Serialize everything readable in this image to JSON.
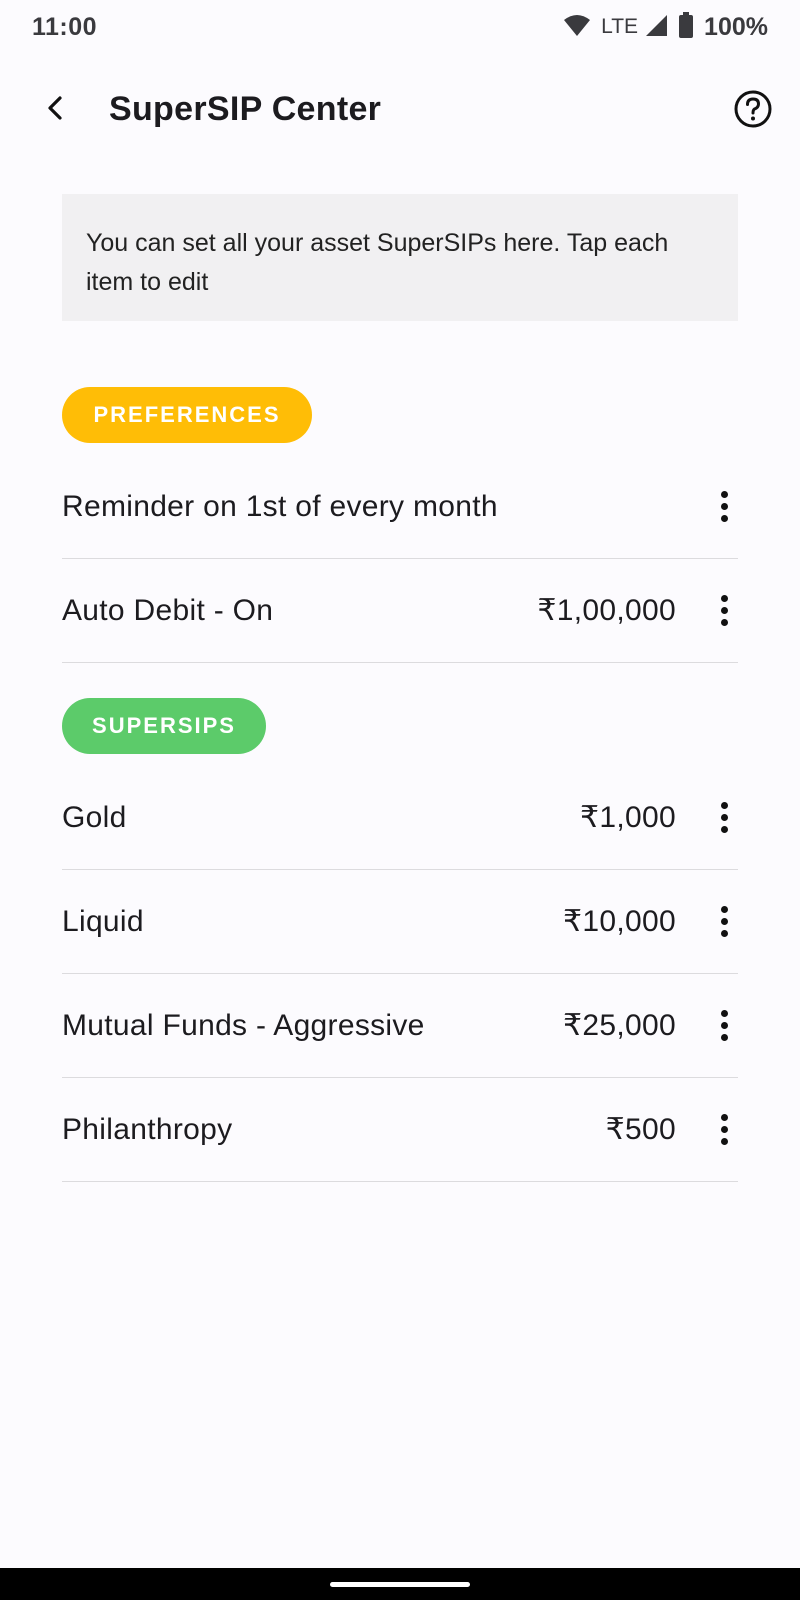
{
  "status_bar": {
    "time": "11:00",
    "network": "LTE",
    "battery": "100%",
    "icons": [
      "wifi-icon",
      "signal-icon",
      "battery-icon"
    ]
  },
  "app_bar": {
    "title": "SuperSIP Center",
    "back_icon": "back-arrow-icon",
    "help_icon": "help-circle-icon"
  },
  "info": {
    "text": "You can set all your asset SuperSIPs here. Tap each item to edit"
  },
  "preferences": {
    "label": "PREFERENCES",
    "color": "#ffbd06",
    "items": [
      {
        "label": "Reminder on 1st of every month",
        "amount": ""
      },
      {
        "label": "Auto Debit - On",
        "amount": "₹1,00,000"
      }
    ]
  },
  "supersips": {
    "label": "SUPERSIPS",
    "color": "#5ccb6a",
    "items": [
      {
        "label": "Gold",
        "amount": "₹1,000"
      },
      {
        "label": "Liquid",
        "amount": "₹10,000"
      },
      {
        "label": "Mutual Funds - Aggressive",
        "amount": "₹25,000"
      },
      {
        "label": "Philanthropy",
        "amount": "₹500"
      }
    ]
  }
}
